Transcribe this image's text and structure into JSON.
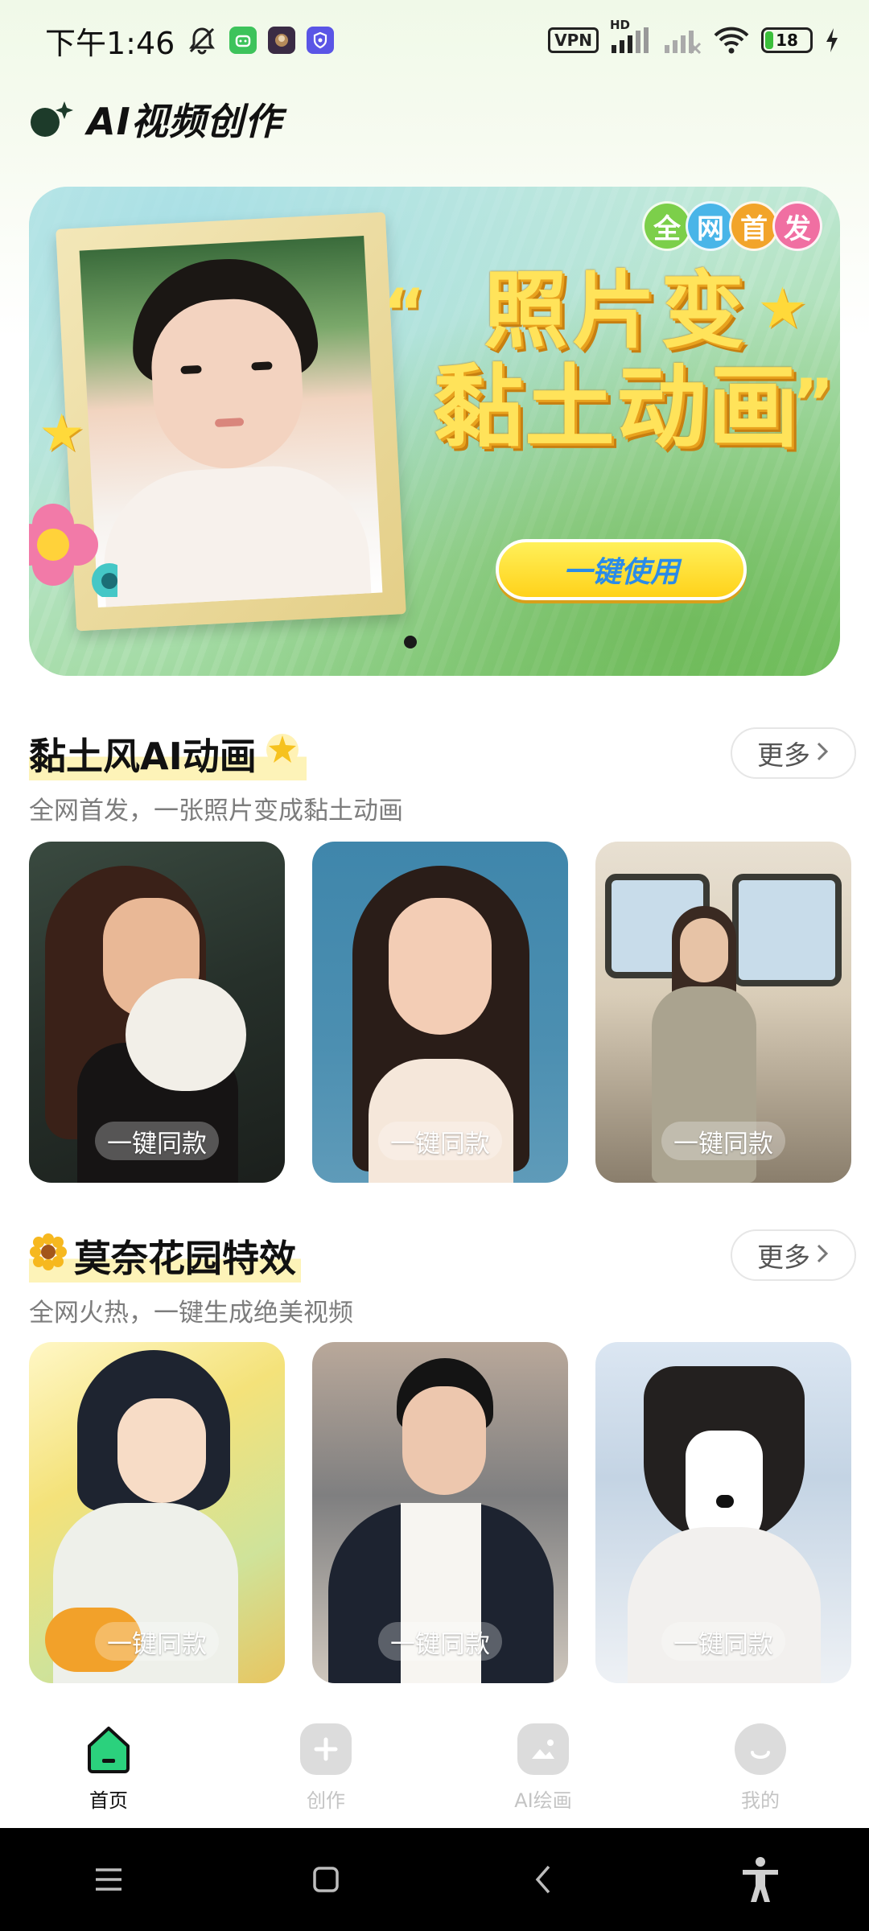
{
  "status_bar": {
    "time": "下午1:46",
    "vpn_label": "VPN",
    "network_label": "HD",
    "battery_level": "18",
    "battery_fraction": 0.18
  },
  "app": {
    "title": "AI视频创作",
    "accent_color": "#1d3b2a"
  },
  "banner": {
    "badge_chars": [
      "全",
      "网",
      "首",
      "发"
    ],
    "badge_colors": [
      "#7ccf4a",
      "#49b5e8",
      "#f2a42a",
      "#f06fa2"
    ],
    "headline_line1": "照片变",
    "headline_line2": "黏土动画",
    "quote_open": "“",
    "quote_close": "”",
    "cta_label": "一键使用",
    "page_count": 1,
    "active_page": 1
  },
  "sections": [
    {
      "title": "黏土风AI动画",
      "title_icon": "sparkle-star-icon",
      "subtitle": "全网首发，一张照片变成黏土动画",
      "more_label": "更多",
      "cards": [
        {
          "label": "一键同款",
          "subject": "clay-girl-holding-dog"
        },
        {
          "label": "一键同款",
          "subject": "clay-girl-portrait"
        },
        {
          "label": "一键同款",
          "subject": "clay-girl-in-bus"
        }
      ]
    },
    {
      "title": "莫奈花园特效",
      "title_icon": "sunflower-icon",
      "subtitle": "全网火热，一键生成绝美视频",
      "more_label": "更多",
      "cards": [
        {
          "label": "一键同款",
          "subject": "anime-girl-flowers"
        },
        {
          "label": "一键同款",
          "subject": "young-man-street"
        },
        {
          "label": "一键同款",
          "subject": "husky-in-snow"
        }
      ]
    }
  ],
  "bottom_nav": [
    {
      "label": "首页",
      "icon": "home-icon",
      "active": true
    },
    {
      "label": "创作",
      "icon": "plus-icon",
      "active": false
    },
    {
      "label": "AI绘画",
      "icon": "image-icon",
      "active": false
    },
    {
      "label": "我的",
      "icon": "profile-icon",
      "active": false
    }
  ],
  "system_nav": [
    "menu-icon",
    "home-square-icon",
    "back-icon",
    "accessibility-icon"
  ]
}
